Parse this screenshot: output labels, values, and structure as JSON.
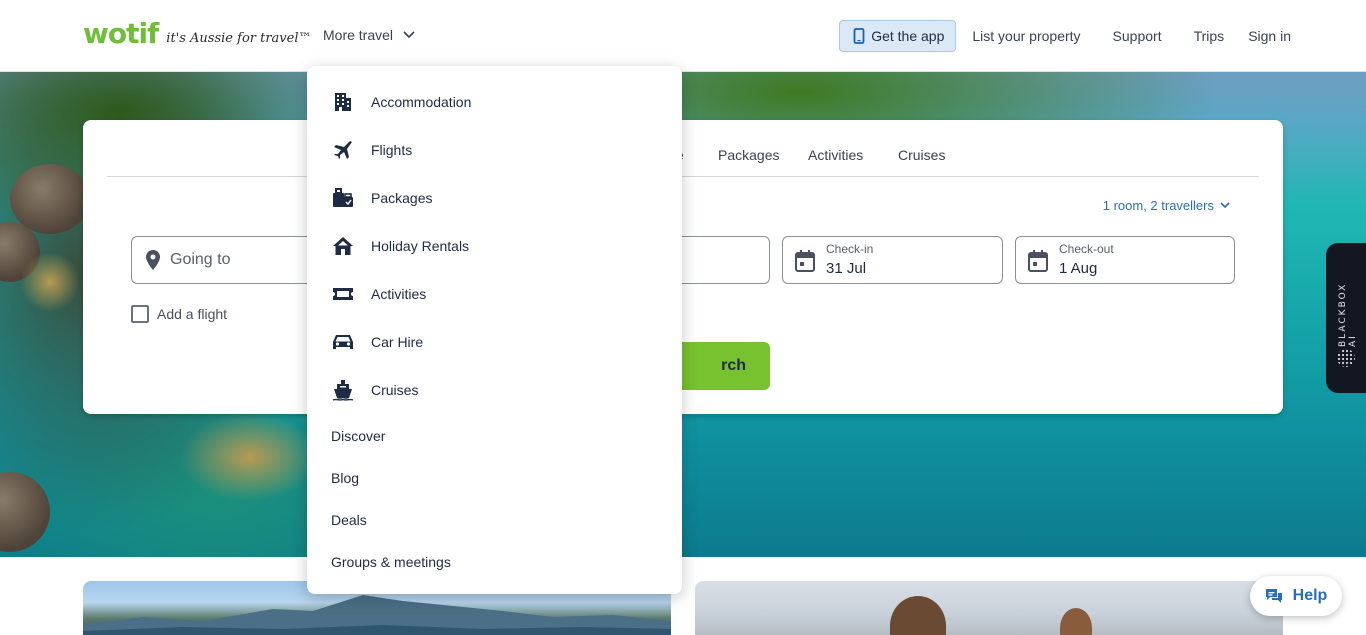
{
  "header": {
    "logo_text": "wotif",
    "tagline": "it's Aussie for travel™",
    "more_travel": "More travel",
    "get_app": "Get the app",
    "nav": [
      "List your property",
      "Support",
      "Trips",
      "Sign in"
    ]
  },
  "search": {
    "tabs_visible": [
      "e",
      "Packages",
      "Activities",
      "Cruises"
    ],
    "travellers": "1 room, 2 travellers",
    "going_to_placeholder": "Going to",
    "checkin_label": "Check-in",
    "checkin_value": "31 Jul",
    "checkout_label": "Check-out",
    "checkout_value": "1 Aug",
    "add_flight": "Add a flight",
    "search_button_partial": "rch"
  },
  "dropdown": {
    "icon_items": [
      {
        "label": "Accommodation",
        "icon": "building-icon"
      },
      {
        "label": "Flights",
        "icon": "plane-icon"
      },
      {
        "label": "Packages",
        "icon": "luggage-icon"
      },
      {
        "label": "Holiday Rentals",
        "icon": "house-icon"
      },
      {
        "label": "Activities",
        "icon": "ticket-icon"
      },
      {
        "label": "Car Hire",
        "icon": "car-icon"
      },
      {
        "label": "Cruises",
        "icon": "ship-icon"
      }
    ],
    "text_items": [
      "Discover",
      "Blog",
      "Deals",
      "Groups & meetings"
    ]
  },
  "widgets": {
    "blackbox": "BLACKBOX AI",
    "help": "Help"
  },
  "colors": {
    "brand_green": "#6fbe3a",
    "search_green": "#78c22f",
    "link_blue": "#2a6ebb",
    "app_button_bg": "#dbe9f7"
  }
}
